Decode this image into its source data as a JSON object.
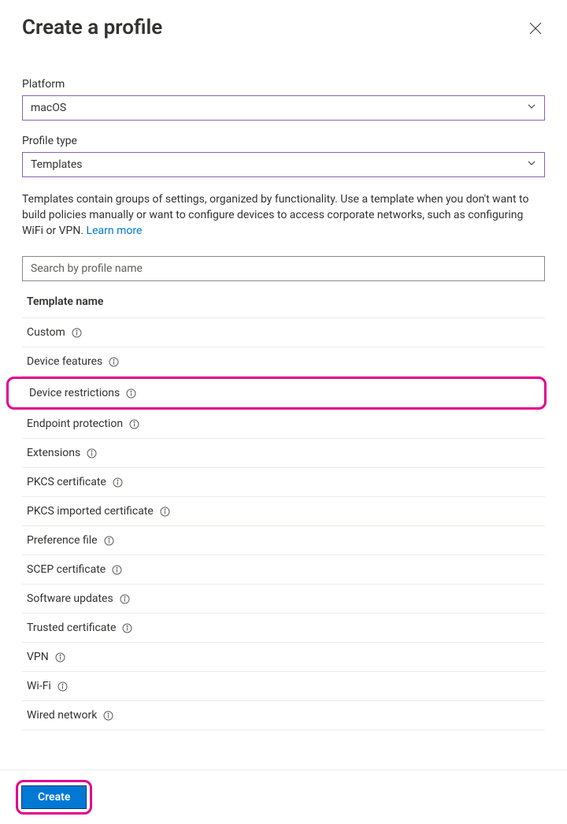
{
  "header": {
    "title": "Create a profile"
  },
  "form": {
    "platform_label": "Platform",
    "platform_value": "macOS",
    "profile_type_label": "Profile type",
    "profile_type_value": "Templates",
    "description": "Templates contain groups of settings, organized by functionality. Use a template when you don't want to build policies manually or want to configure devices to access corporate networks, such as configuring WiFi or VPN. ",
    "learn_more": "Learn more",
    "search_placeholder": "Search by profile name"
  },
  "table": {
    "header": "Template name",
    "items": [
      {
        "label": "Custom",
        "highlighted": false
      },
      {
        "label": "Device features",
        "highlighted": false
      },
      {
        "label": "Device restrictions",
        "highlighted": true
      },
      {
        "label": "Endpoint protection",
        "highlighted": false
      },
      {
        "label": "Extensions",
        "highlighted": false
      },
      {
        "label": "PKCS certificate",
        "highlighted": false
      },
      {
        "label": "PKCS imported certificate",
        "highlighted": false
      },
      {
        "label": "Preference file",
        "highlighted": false
      },
      {
        "label": "SCEP certificate",
        "highlighted": false
      },
      {
        "label": "Software updates",
        "highlighted": false
      },
      {
        "label": "Trusted certificate",
        "highlighted": false
      },
      {
        "label": "VPN",
        "highlighted": false
      },
      {
        "label": "Wi-Fi",
        "highlighted": false
      },
      {
        "label": "Wired network",
        "highlighted": false
      }
    ]
  },
  "footer": {
    "create_label": "Create"
  }
}
